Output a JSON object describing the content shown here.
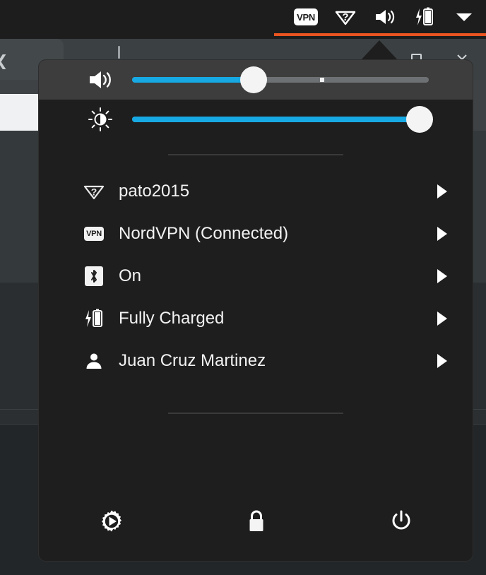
{
  "topbar": {
    "tray": [
      {
        "name": "vpn-indicator",
        "label": "VPN",
        "kind": "badge"
      },
      {
        "name": "wifi-unknown-indicator",
        "label": "",
        "kind": "wifi-question"
      },
      {
        "name": "volume-indicator",
        "label": "",
        "kind": "speaker"
      },
      {
        "name": "battery-charging-indicator",
        "label": "",
        "kind": "battery-bolt"
      },
      {
        "name": "system-menu-toggle",
        "label": "",
        "kind": "chevron-down"
      }
    ],
    "underline_color": "#e95420",
    "background_color": "#1d1d1d"
  },
  "menu": {
    "background_color": "#1e1e1e",
    "sliders": [
      {
        "name": "volume-slider",
        "icon": "speaker-icon",
        "value": 41,
        "marker_at": 64,
        "fill_color": "#17a9e3",
        "hovered": true
      },
      {
        "name": "brightness-slider",
        "icon": "brightness-icon",
        "value": 97,
        "marker_at": null,
        "fill_color": "#17a9e3",
        "hovered": false
      }
    ],
    "items": [
      {
        "icon": "wifi-question-icon",
        "label": "pato2015",
        "caret": true
      },
      {
        "icon": "vpn-icon",
        "label": "NordVPN (Connected)",
        "caret": true
      },
      {
        "icon": "bluetooth-icon",
        "label": "On",
        "caret": true
      },
      {
        "icon": "battery-charging-icon",
        "label": "Fully Charged",
        "caret": true
      },
      {
        "icon": "user-icon",
        "label": "Juan Cruz Martinez",
        "caret": true
      }
    ],
    "actions": [
      {
        "name": "settings-button",
        "icon": "gear-icon",
        "label": "Settings"
      },
      {
        "name": "lock-button",
        "icon": "lock-icon",
        "label": "Lock"
      },
      {
        "name": "power-button",
        "icon": "power-icon",
        "label": "Power Off"
      }
    ]
  }
}
